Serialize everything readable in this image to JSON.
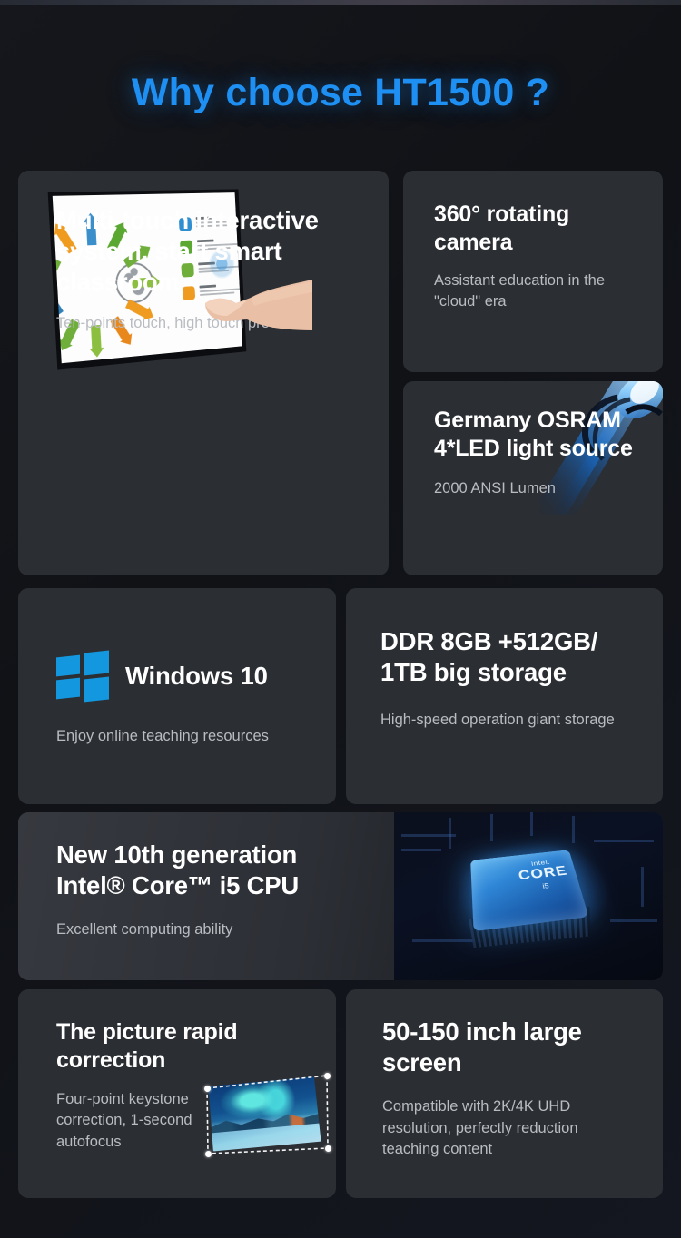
{
  "page": {
    "title": "Why choose HT1500 ?",
    "accent_color": "#1f90f3",
    "background_color": "#111318",
    "card_color": "#2b2e33"
  },
  "cards": [
    {
      "id": "multitouch",
      "heading": "Multi-touch interactive system, start smart classroom",
      "subtext": "Ten-points touch, high touch precision",
      "image": "interactive-whiteboard-hand-touch"
    },
    {
      "id": "camera",
      "heading": "360° rotating camera",
      "subtext": "Assistant education in the \"cloud\" era"
    },
    {
      "id": "led",
      "heading": "Germany OSRAM 4*LED light source",
      "subtext": "2000 ANSI Lumen",
      "image": "blue-led-lamp-beam"
    },
    {
      "id": "windows",
      "heading": "Windows 10",
      "subtext": "Enjoy online teaching resources",
      "image": "windows-logo"
    },
    {
      "id": "storage",
      "heading": "DDR 8GB +512GB/ 1TB big storage",
      "subtext": "High-speed operation giant storage"
    },
    {
      "id": "cpu",
      "heading_line1": "New 10th generation",
      "heading_line2": "Intel® Core™ i5 CPU",
      "subtext": "Excellent computing ability",
      "image": "intel-core-i5-chip-on-motherboard",
      "chip_label_top": "intel.",
      "chip_label_mid": "CORE",
      "chip_label_bottom": "i5"
    },
    {
      "id": "keystone",
      "heading": "The picture rapid correction",
      "subtext": "Four-point keystone correction, 1-second autofocus",
      "image": "four-point-keystone-aurora-photo"
    },
    {
      "id": "screen-size",
      "heading": "50-150 inch large screen",
      "subtext": "Compatible with 2K/4K UHD resolution, perfectly reduction teaching content"
    }
  ]
}
